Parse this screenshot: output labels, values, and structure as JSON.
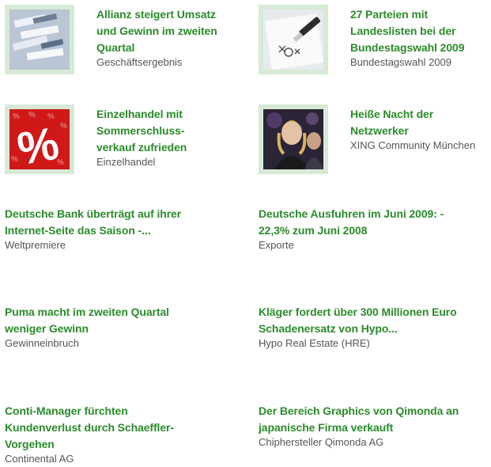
{
  "colors": {
    "headline": "#2a8c2a",
    "category": "#555555",
    "thumb_frame": "#d6ead6"
  },
  "featured": [
    {
      "headline_lines": [
        "Allianz steigert Umsatz",
        "und Gewinn im zweiten",
        "Quartal"
      ],
      "category": "Geschäftsergebnis",
      "thumb_icon": "file-folders-photo"
    },
    {
      "headline_lines": [
        "27 Parteien mit",
        "Landeslisten bei der",
        "Bundestagswahl 2009"
      ],
      "category": "Bundestagswahl 2009",
      "thumb_icon": "ballot-pen-photo"
    },
    {
      "headline_lines": [
        "Einzelhandel mit",
        "Sommerschluss-",
        "verkauf zufrieden"
      ],
      "category": "Einzelhandel",
      "thumb_icon": "percent-sign-photo"
    },
    {
      "headline_lines": [
        "Heiße Nacht der",
        "Netzwerker"
      ],
      "category": "XING Community München",
      "thumb_icon": "people-party-photo"
    }
  ],
  "articles": [
    {
      "headline_lines": [
        "Deutsche Bank überträgt auf ihrer",
        "Internet-Seite das Saison -..."
      ],
      "category": "Weltpremiere"
    },
    {
      "headline_lines": [
        "Deutsche Ausfuhren im Juni 2009: -",
        "22,3% zum Juni 2008"
      ],
      "category": "Exporte"
    },
    {
      "headline_lines": [
        "Puma macht im zweiten Quartal",
        "weniger Gewinn"
      ],
      "category": "Gewinneinbruch"
    },
    {
      "headline_lines": [
        "Kläger fordert über 300 Millionen Euro",
        "Schadenersatz von Hypo..."
      ],
      "category": "Hypo Real Estate (HRE)"
    },
    {
      "headline_lines": [
        "Conti-Manager fürchten",
        "Kundenverlust durch Schaeffler-",
        "Vorgehen"
      ],
      "category": "Continental AG"
    },
    {
      "headline_lines": [
        "Der Bereich Graphics von Qimonda an",
        "japanische Firma verkauft"
      ],
      "category": "Chiphersteller Qimonda AG"
    }
  ]
}
